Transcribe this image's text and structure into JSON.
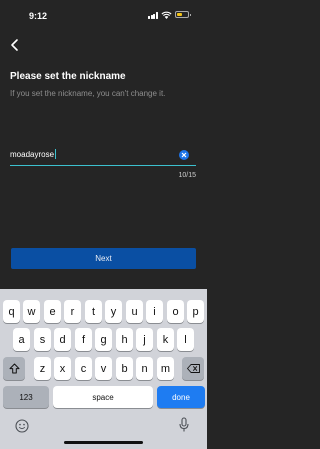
{
  "status_bar": {
    "time": "9:12",
    "battery_color": "#f5c518"
  },
  "header": {
    "back_icon": "chevron-left-icon"
  },
  "page": {
    "title": "Please set the nickname",
    "subtitle": "If you set the nickname, you can't change it."
  },
  "nickname_field": {
    "value": "moadayrose",
    "counter": "10/15",
    "clear_icon": "clear-icon"
  },
  "next_button": {
    "label": "Next"
  },
  "keyboard": {
    "row1": [
      "q",
      "w",
      "e",
      "r",
      "t",
      "y",
      "u",
      "i",
      "o",
      "p"
    ],
    "row2": [
      "a",
      "s",
      "d",
      "f",
      "g",
      "h",
      "j",
      "k",
      "l"
    ],
    "row3": [
      "z",
      "x",
      "c",
      "v",
      "b",
      "n",
      "m"
    ],
    "numbers_label": "123",
    "space_label": "space",
    "done_label": "done"
  },
  "colors": {
    "background": "#252525",
    "accent": "#3cc1cf",
    "button": "#0a4fa3",
    "clear": "#1d74e8"
  }
}
